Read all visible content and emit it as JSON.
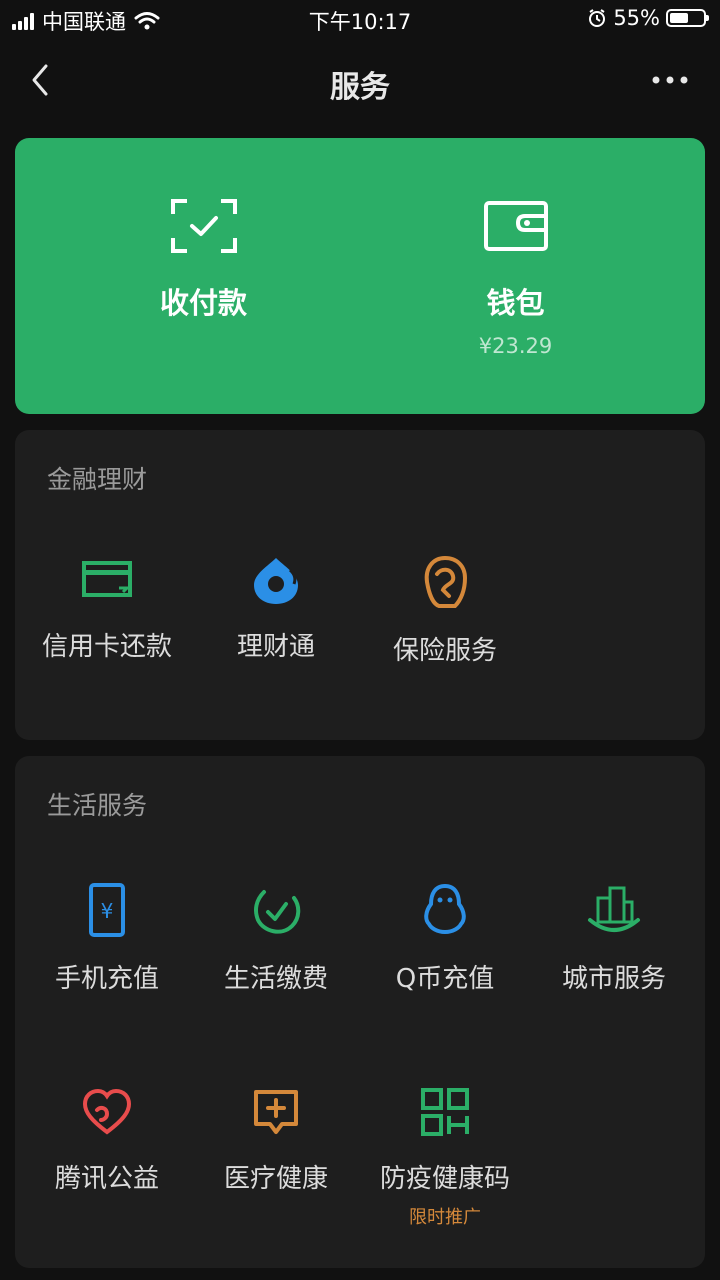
{
  "status_bar": {
    "carrier": "中国联通",
    "time": "下午10:17",
    "battery": "55%",
    "battery_level": 0.55
  },
  "nav": {
    "title": "服务",
    "back_icon": "chevron-left-icon",
    "more_icon": "more-dots-icon"
  },
  "green_card": {
    "background": "#2bae67",
    "pay": {
      "label": "收付款",
      "icon": "scan-check-icon"
    },
    "wallet": {
      "label": "钱包",
      "balance": "¥23.29",
      "icon": "wallet-icon"
    }
  },
  "finance": {
    "title": "金融理财",
    "items": [
      {
        "label": "信用卡还款",
        "icon": "credit-card-icon",
        "color": "#2bae67"
      },
      {
        "label": "理财通",
        "icon": "wealth-drop-icon",
        "color": "#2b8fe6"
      },
      {
        "label": "保险服务",
        "icon": "insurance-icon",
        "color": "#d4883a"
      }
    ]
  },
  "life": {
    "title": "生活服务",
    "items": [
      {
        "label": "手机充值",
        "icon": "phone-recharge-icon",
        "color": "#2b8fe6"
      },
      {
        "label": "生活缴费",
        "icon": "utility-bill-icon",
        "color": "#2bae67"
      },
      {
        "label": "Q币充值",
        "icon": "qq-penguin-icon",
        "color": "#2b8fe6"
      },
      {
        "label": "城市服务",
        "icon": "city-buildings-icon",
        "color": "#2bae67"
      },
      {
        "label": "腾讯公益",
        "icon": "charity-heart-icon",
        "color": "#e84c4c"
      },
      {
        "label": "医疗健康",
        "icon": "medical-plus-icon",
        "color": "#d4883a"
      },
      {
        "label": "防疫健康码",
        "icon": "qr-code-icon",
        "color": "#2bae67",
        "promo": "限时推广"
      }
    ]
  }
}
